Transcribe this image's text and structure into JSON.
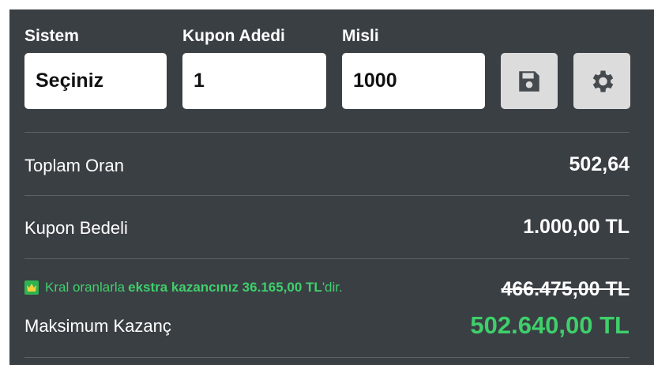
{
  "form": {
    "sistem_label": "Sistem",
    "sistem_value": "Seçiniz",
    "kupon_adedi_label": "Kupon Adedi",
    "kupon_adedi_value": "1",
    "misli_label": "Misli",
    "misli_value": "1000",
    "save_icon": "floppy-disk-icon",
    "settings_icon": "gear-icon"
  },
  "summary": {
    "toplam_oran_label": "Toplam Oran",
    "toplam_oran_value": "502,64",
    "kupon_bedeli_label": "Kupon Bedeli",
    "kupon_bedeli_value": "1.000,00 TL",
    "promo_prefix": "Kral oranlarla",
    "promo_bold": "ekstra kazancınız 36.165,00 TL",
    "promo_suffix": "'dir.",
    "old_max_value": "466.475,00 TL",
    "max_kazanc_label": "Maksimum Kazanç",
    "max_kazanc_value": "502.640,00 TL"
  },
  "colors": {
    "panel_bg": "#3a3f44",
    "accent_green": "#3fcf6b",
    "button_bg": "#dcdcdc"
  }
}
